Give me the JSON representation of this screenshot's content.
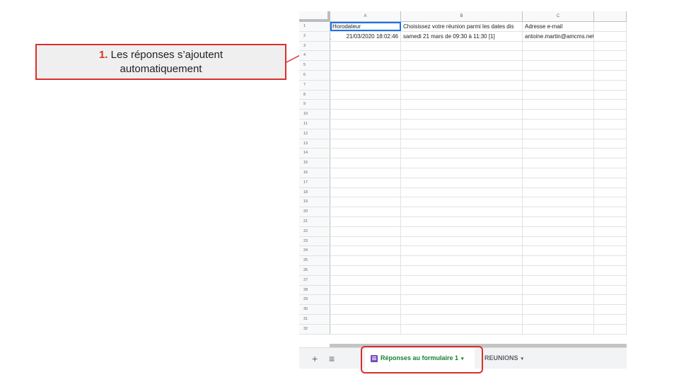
{
  "callout": {
    "number": "1.",
    "text_line1": " Les réponses s’ajoutent",
    "text_line2": "automatiquement"
  },
  "columns": [
    "A",
    "B",
    "C"
  ],
  "header_row": {
    "a": "Horodateur",
    "b": "Choisissez votre réunion parmi les dates dis",
    "c": "Adresse e-mail"
  },
  "data_row": {
    "a": "21/03/2020 18:02:46",
    "b": "samedi 21 mars de 09:30 à 11:30 [1]",
    "c": "antoine.martin@amcms.net"
  },
  "row_numbers": [
    "1",
    "2",
    "3",
    "4",
    "5",
    "6",
    "7",
    "8",
    "9",
    "10",
    "11",
    "12",
    "13",
    "14",
    "15",
    "16",
    "17",
    "18",
    "19",
    "20",
    "21",
    "22",
    "23",
    "24",
    "25",
    "26",
    "27",
    "28",
    "29",
    "30",
    "31",
    "32"
  ],
  "tabs": {
    "add_icon": "+",
    "list_icon": "≡",
    "active_label": "Réponses au formulaire 1",
    "other_label": "REUNIONS",
    "caret": "▾"
  },
  "colors": {
    "accent_red": "#d9302c",
    "tab_green": "#188038",
    "form_purple": "#7248b9"
  }
}
